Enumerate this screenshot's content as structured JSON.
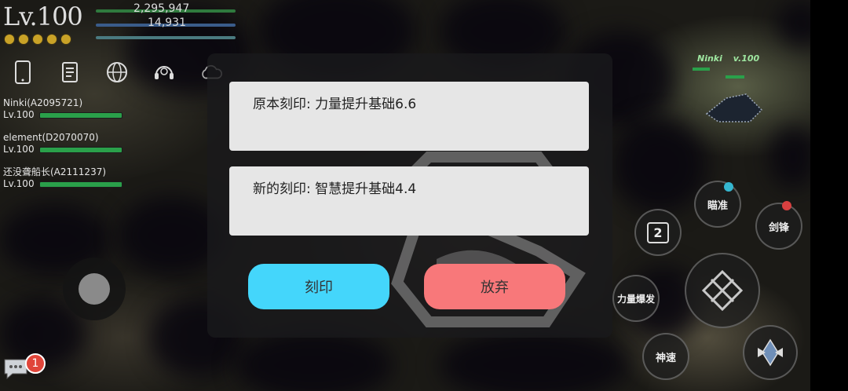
{
  "hud": {
    "level_prefix": "Lv.",
    "level_value": "100",
    "hp_value": "2,295,947",
    "mp_value": "14,931",
    "stars": 5,
    "icons": [
      "phone-icon",
      "scroll-icon",
      "globe-icon",
      "headset-icon",
      "cloud-icon"
    ]
  },
  "party": [
    {
      "name": "Ninki(A2095721)",
      "level": "Lv.100"
    },
    {
      "name": "element(D2070070)",
      "level": "Lv.100"
    },
    {
      "name": "还没聋船长(A2111237)",
      "level": "Lv.100"
    }
  ],
  "dialog": {
    "original_engraving": "原本刻印: 力量提升基础6.6",
    "new_engraving": "新的刻印: 智慧提升基础4.4",
    "engrave_button": "刻印",
    "abandon_button": "放弃"
  },
  "skills": {
    "aim": "瞄准",
    "sword_lock": "剑锋",
    "slot_number": "2",
    "power_burst": "力量爆发",
    "god_speed": "神速"
  },
  "world_nametag": {
    "name": "Ninki",
    "level": "v.100"
  },
  "chat": {
    "unread": "1"
  },
  "colors": {
    "engrave_button": "#44d6fb",
    "abandon_button": "#f8787a",
    "hp_bar": "#2aa04a",
    "star": "#c9a227",
    "badge": "#e0453a"
  }
}
